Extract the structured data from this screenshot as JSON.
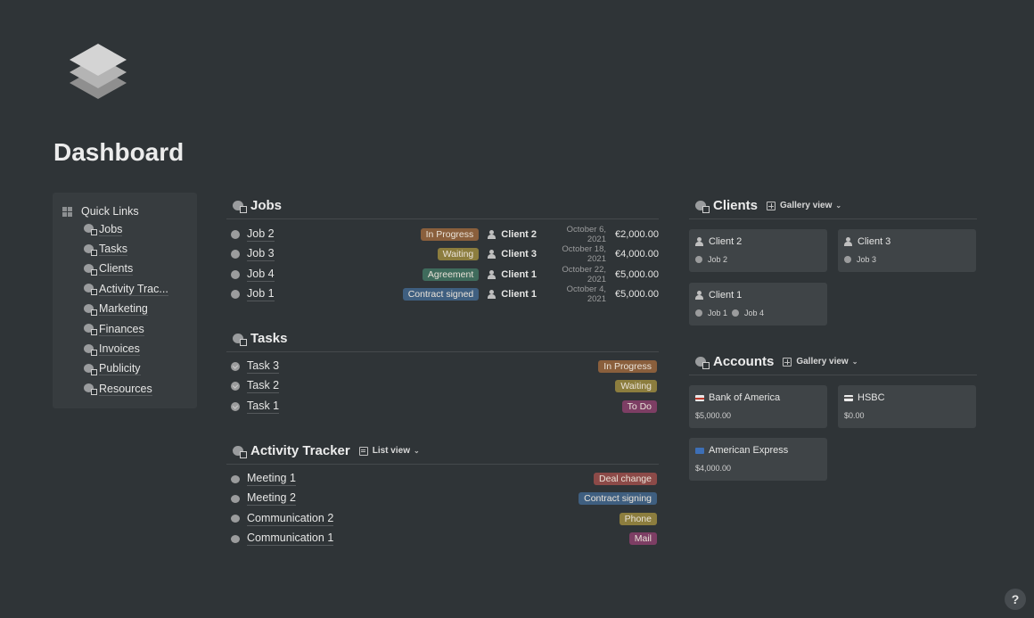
{
  "page": {
    "title": "Dashboard",
    "icon": "layers-icon"
  },
  "quick_links": {
    "title": "Quick Links",
    "items": [
      {
        "label": "Jobs",
        "icon": "jobs-icon"
      },
      {
        "label": "Tasks",
        "icon": "tasks-icon"
      },
      {
        "label": "Clients",
        "icon": "clients-icon"
      },
      {
        "label": "Activity Trac...",
        "icon": "activity-icon"
      },
      {
        "label": "Marketing",
        "icon": "marketing-icon"
      },
      {
        "label": "Finances",
        "icon": "finances-icon"
      },
      {
        "label": "Invoices",
        "icon": "invoices-icon"
      },
      {
        "label": "Publicity",
        "icon": "publicity-icon"
      },
      {
        "label": "Resources",
        "icon": "resources-icon"
      }
    ]
  },
  "jobs": {
    "title": "Jobs",
    "rows": [
      {
        "name": "Job 2",
        "status": "In Progress",
        "status_color": "#8a5f3c",
        "client": "Client 2",
        "date": "October 6, 2021",
        "amount": "€2,000.00"
      },
      {
        "name": "Job 3",
        "status": "Waiting",
        "status_color": "#8c7d3e",
        "client": "Client 3",
        "date": "October 18, 2021",
        "amount": "€4,000.00"
      },
      {
        "name": "Job 4",
        "status": "Agreement",
        "status_color": "#3f6b5c",
        "client": "Client 1",
        "date": "October 22, 2021",
        "amount": "€5,000.00"
      },
      {
        "name": "Job 1",
        "status": "Contract signed",
        "status_color": "#3f5f80",
        "client": "Client 1",
        "date": "October 4, 2021",
        "amount": "€5,000.00"
      }
    ]
  },
  "tasks": {
    "title": "Tasks",
    "rows": [
      {
        "name": "Task 3",
        "status": "In Progress",
        "status_color": "#8a5f3c"
      },
      {
        "name": "Task 2",
        "status": "Waiting",
        "status_color": "#8c7d3e"
      },
      {
        "name": "Task 1",
        "status": "To Do",
        "status_color": "#7d3e64"
      }
    ]
  },
  "activity": {
    "title": "Activity Tracker",
    "view": "List view",
    "rows": [
      {
        "name": "Meeting 1",
        "tag": "Deal change",
        "tag_color": "#8c4a48"
      },
      {
        "name": "Meeting 2",
        "tag": "Contract signing",
        "tag_color": "#3f5f80"
      },
      {
        "name": "Communication 2",
        "tag": "Phone",
        "tag_color": "#8c7d3e"
      },
      {
        "name": "Communication 1",
        "tag": "Mail",
        "tag_color": "#7d3e64"
      }
    ]
  },
  "clients": {
    "title": "Clients",
    "view": "Gallery view",
    "cards": [
      {
        "name": "Client 2",
        "jobs": [
          "Job 2"
        ]
      },
      {
        "name": "Client 3",
        "jobs": [
          "Job 3"
        ]
      },
      {
        "name": "Client 1",
        "jobs": [
          "Job 1",
          "Job 4"
        ]
      }
    ]
  },
  "accounts": {
    "title": "Accounts",
    "view": "Gallery view",
    "cards": [
      {
        "name": "Bank of America",
        "balance": "$5,000.00",
        "icon": "bank-of-america-flag-icon"
      },
      {
        "name": "HSBC",
        "balance": "$0.00",
        "icon": "hsbc-card-icon"
      },
      {
        "name": "American Express",
        "balance": "$4,000.00",
        "icon": "amex-card-icon"
      }
    ]
  },
  "help": {
    "label": "?"
  }
}
